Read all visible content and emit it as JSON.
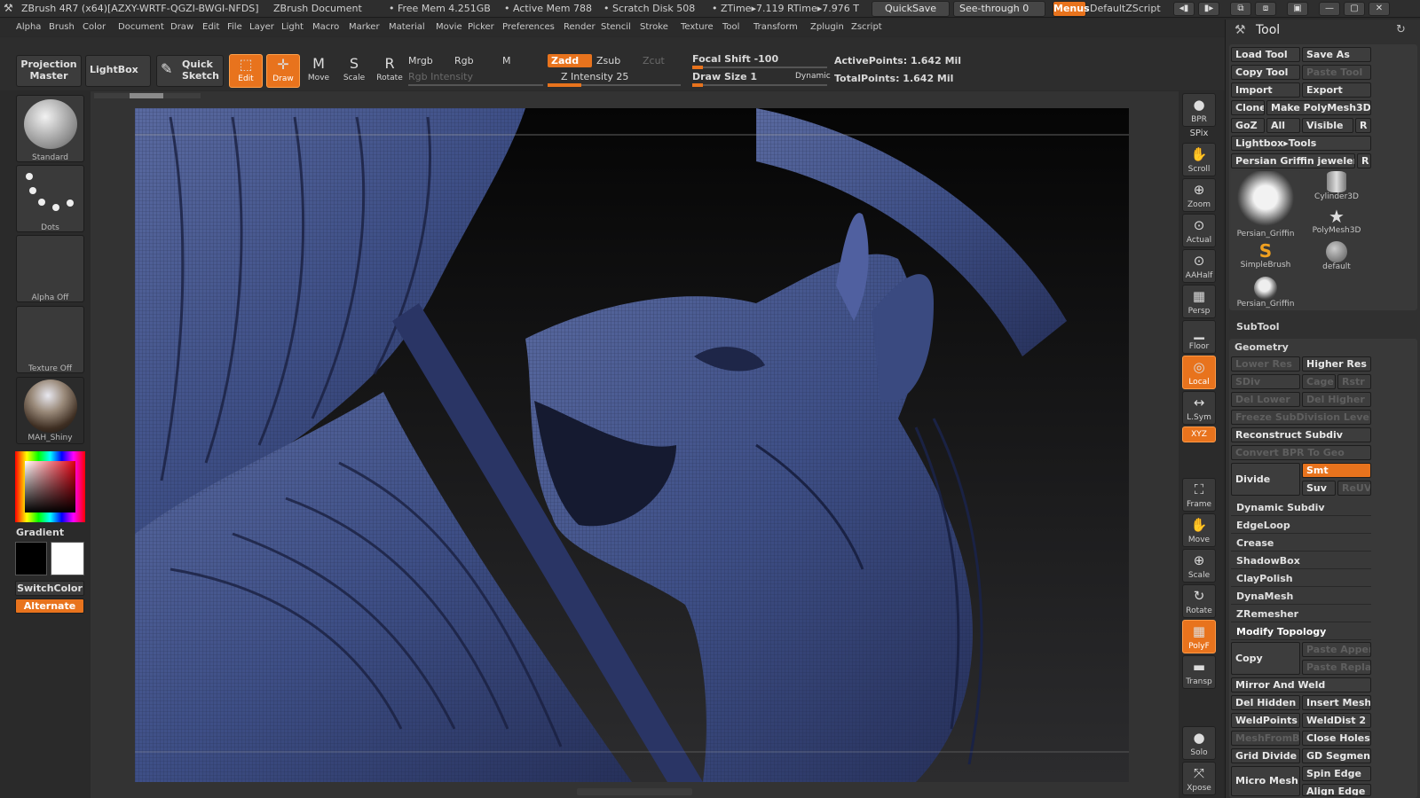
{
  "titlebar": {
    "app": "ZBrush 4R7 (x64)[AZXY-WRTF-QGZI-BWGI-NFDS]",
    "document": "ZBrush Document",
    "free_mem": "• Free Mem 4.251GB",
    "active_mem": "• Active Mem 788",
    "scratch": "• Scratch Disk 508",
    "ztime": "• ZTime▸7.119 RTime▸7.976 T",
    "quicksave": "QuickSave",
    "see_through": "See-through  0",
    "menus": "Menus",
    "script": "DefaultZScript"
  },
  "menubar": [
    "Alpha",
    "Brush",
    "Color",
    "Document",
    "Draw",
    "Edit",
    "File",
    "Layer",
    "Light",
    "Macro",
    "Marker",
    "Material",
    "Movie",
    "Picker",
    "Preferences",
    "Render",
    "Stencil",
    "Stroke",
    "Texture",
    "Tool",
    "Transform",
    "Zplugin",
    "Zscript"
  ],
  "toolbar": {
    "projection_master": "Projection Master",
    "lightbox": "LightBox",
    "quick_sketch": "Quick Sketch",
    "edit": "Edit",
    "draw": "Draw",
    "move": "Move",
    "scale": "Scale",
    "rotate": "Rotate",
    "mrgb": "Mrgb",
    "rgb": "Rgb",
    "m": "M",
    "zadd": "Zadd",
    "zsub": "Zsub",
    "zcut": "Zcut",
    "rgb_intensity": "Rgb Intensity",
    "z_intensity": "Z Intensity 25",
    "focal_shift": "Focal Shift -100",
    "draw_size": "Draw Size 1",
    "dynamic": "Dynamic",
    "active_points": "ActivePoints: 1.642  Mil",
    "total_points": "TotalPoints: 1.642  Mil",
    "z_intensity_level": 0.25,
    "focal_shift_level": 0.0,
    "draw_size_level": 0.01
  },
  "leftpanel": {
    "brush": "Standard",
    "stroke": "Dots",
    "alpha": "Alpha  Off",
    "texture": "Texture  Off",
    "material": "MAH_Shiny",
    "gradient": "Gradient",
    "switchcolor": "SwitchColor",
    "alternate": "Alternate"
  },
  "rightshelf": [
    {
      "label": "BPR",
      "icon": "bpr-icon"
    },
    {
      "label": "SPix",
      "icon": "spix-icon"
    },
    {
      "label": "Scroll",
      "icon": "scroll-icon"
    },
    {
      "label": "Zoom",
      "icon": "zoom-icon"
    },
    {
      "label": "Actual",
      "icon": "actual-icon"
    },
    {
      "label": "AAHalf",
      "icon": "aahalf-icon"
    },
    {
      "label": "Persp",
      "icon": "persp-icon"
    },
    {
      "label": "Floor",
      "icon": "floor-icon"
    },
    {
      "label": "Local",
      "icon": "local-icon"
    },
    {
      "label": "L.Sym",
      "icon": "lsym-icon"
    },
    {
      "label": "XYZ",
      "icon": "xyz-icon"
    },
    {
      "label": "Frame",
      "icon": "frame-icon"
    },
    {
      "label": "Move",
      "icon": "move-icon"
    },
    {
      "label": "Scale",
      "icon": "scale-icon"
    },
    {
      "label": "Rotate",
      "icon": "rotate-icon"
    },
    {
      "label": "PolyF",
      "icon": "polyf-icon"
    },
    {
      "label": "Transp",
      "icon": "transp-icon"
    },
    {
      "label": "Solo",
      "icon": "solo-icon"
    },
    {
      "label": "Xpose",
      "icon": "xpose-icon"
    }
  ],
  "toolpanel": {
    "title": "Tool",
    "load_tool": "Load Tool",
    "save_as": "Save As",
    "copy_tool": "Copy Tool",
    "paste_tool": "Paste Tool",
    "import": "Import",
    "export": "Export",
    "clone": "Clone",
    "make_polymesh": "Make PolyMesh3D",
    "goz": "GoZ",
    "all": "All",
    "visible": "Visible",
    "r": "R",
    "lightbox_tools": "Lightbox▸Tools",
    "current_tool": "Persian Griffin jeweler",
    "thumbs": [
      "Persian_Griffin",
      "Cylinder3D",
      "PolyMesh3D",
      "SimpleBrush",
      "default",
      "Persian_Griffin"
    ],
    "subtool": "SubTool",
    "geometry": "Geometry",
    "lower_res": "Lower Res",
    "higher_res": "Higher Res",
    "sdiv": "SDiv",
    "cage": "Cage",
    "rstr": "Rstr",
    "del_lower": "Del Lower",
    "del_higher": "Del Higher",
    "freeze": "Freeze SubDivision Levels",
    "reconstruct": "Reconstruct Subdiv",
    "convert_bpr": "Convert BPR To Geo",
    "divide": "Divide",
    "smt": "Smt",
    "suv": "Suv",
    "reuv": "ReUV",
    "dynamic_subdiv": "Dynamic Subdiv",
    "edgeloop": "EdgeLoop",
    "crease": "Crease",
    "shadowbox": "ShadowBox",
    "claypolish": "ClayPolish",
    "dynamesh": "DynaMesh",
    "zremesher": "ZRemesher",
    "modify_topology": "Modify Topology",
    "copy": "Copy",
    "paste_append": "Paste Appen",
    "paste_replace": "Paste Replac",
    "mirror_weld": "Mirror And Weld",
    "del_hidden": "Del Hidden",
    "insert_mesh": "Insert Mesh",
    "weldpoints": "WeldPoints",
    "welddist": "WeldDist 2",
    "meshfrombrush": "MeshFromBr",
    "close_holes": "Close Holes",
    "grid_divide": "Grid Divide",
    "gd_segments": "GD Segments",
    "micro_mesh": "Micro Mesh",
    "spin_edge": "Spin Edge",
    "align_edge": "Align Edge"
  },
  "colors": {
    "accent": "#e8731d",
    "mesh": "#3e4f86",
    "panel": "#303030"
  }
}
